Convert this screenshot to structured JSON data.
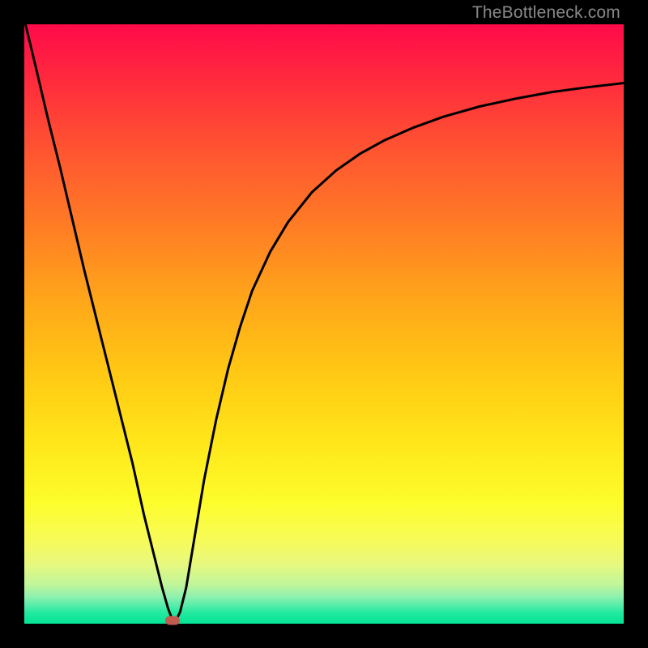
{
  "watermark": "TheBottleneck.com",
  "chart_data": {
    "type": "line",
    "title": "",
    "xlabel": "",
    "ylabel": "",
    "xlim": [
      0,
      100
    ],
    "ylim": [
      0,
      100
    ],
    "grid": false,
    "series": [
      {
        "name": "curve",
        "x": [
          0.2,
          2,
          4,
          6,
          8,
          10,
          12,
          14,
          16,
          18,
          20,
          21.5,
          23,
          24,
          24.7,
          25.3,
          26,
          27,
          28,
          30,
          32,
          34,
          36,
          38,
          41,
          44,
          48,
          52,
          56,
          60,
          65,
          70,
          76,
          82,
          88,
          94,
          100
        ],
        "values": [
          100,
          92.5,
          84,
          76,
          67.5,
          59,
          51,
          43,
          35,
          27,
          18,
          12,
          6,
          2.5,
          0.7,
          0.5,
          2,
          6,
          12,
          24,
          34,
          42.5,
          49.5,
          55.5,
          62,
          67,
          72,
          75.6,
          78.4,
          80.6,
          82.8,
          84.6,
          86.3,
          87.6,
          88.7,
          89.5,
          90.2
        ]
      }
    ],
    "marker": {
      "x": 24.7,
      "y": 0.6
    },
    "background_gradient": {
      "orientation": "vertical",
      "top_color": "#ff0a4a",
      "bottom_color": "#04e496"
    }
  }
}
